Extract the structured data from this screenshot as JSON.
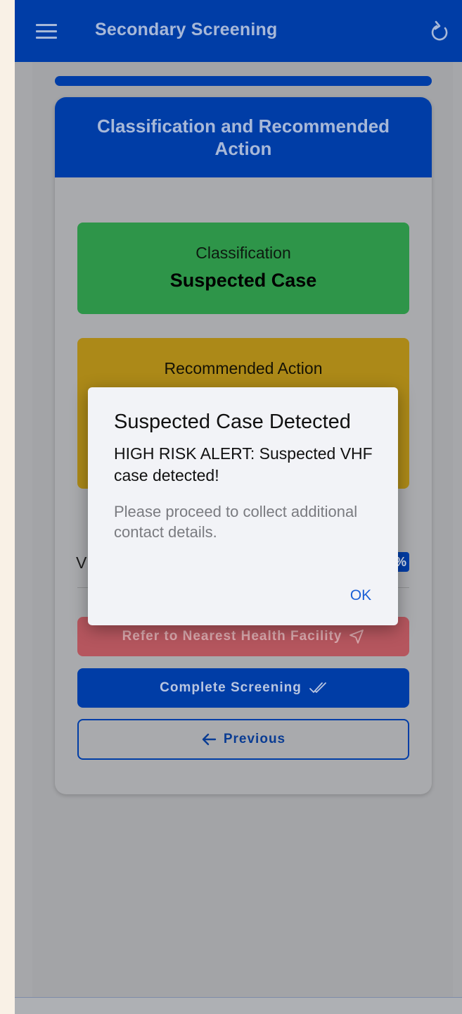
{
  "appbar": {
    "title": "Secondary Screening",
    "menu_icon": "hamburger-menu-icon",
    "refresh_icon": "refresh-icon"
  },
  "card": {
    "header": "Classification and Recommended Action",
    "classification": {
      "label": "Classification",
      "value": "Suspected Case"
    },
    "recommended_action": {
      "label": "Recommended Action"
    },
    "partial_text": "V",
    "partial_badge": "%"
  },
  "buttons": {
    "refer": "Refer to Nearest Health Facility",
    "complete": "Complete Screening",
    "previous": "Previous"
  },
  "dialog": {
    "title": "Suspected Case Detected",
    "alert": "HIGH RISK ALERT: Suspected VHF case detected!",
    "message": "Please proceed to collect additional contact details.",
    "ok": "OK"
  },
  "colors": {
    "primary": "#003da6",
    "classification_green": "#2e9549",
    "action_amber": "#ac8918",
    "refer_red": "#b5565e",
    "dialog_bg": "#f2f3f7",
    "ok_link": "#1a5fd6"
  }
}
